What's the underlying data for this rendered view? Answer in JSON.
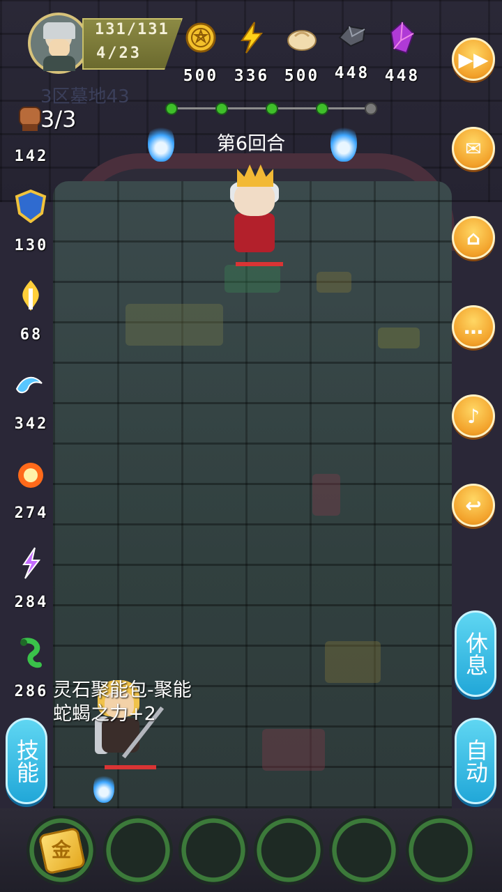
{
  "header": {
    "hp": "131/131",
    "level": "4/23",
    "area": "3区墓地43",
    "resources": [
      {
        "icon": "gold-coin-icon",
        "value": "500"
      },
      {
        "icon": "lightning-energy-icon",
        "value": "336"
      },
      {
        "icon": "bun-food-icon",
        "value": "500"
      },
      {
        "icon": "iron-ore-icon",
        "value": "448"
      },
      {
        "icon": "purple-crystal-icon",
        "value": "448"
      }
    ]
  },
  "battle": {
    "round_label": "第6回合",
    "progress": {
      "total": 5,
      "completed": 4
    },
    "message_line1": "灵石聚能包-聚能",
    "message_line2": "蛇蝎之力+2"
  },
  "stats": {
    "attack_charges": "3/3",
    "items": [
      {
        "icon": "fist-attack-icon",
        "value": "142"
      },
      {
        "icon": "shield-defense-icon",
        "value": "130"
      },
      {
        "icon": "fire-sword-icon",
        "value": "68"
      },
      {
        "icon": "water-wave-icon",
        "value": "342"
      },
      {
        "icon": "fireball-icon",
        "value": "274"
      },
      {
        "icon": "lightning-rune-icon",
        "value": "284"
      },
      {
        "icon": "green-serpent-icon",
        "value": "286"
      }
    ]
  },
  "right_buttons": [
    {
      "name": "fast-forward",
      "icon": "fast-forward-icon"
    },
    {
      "name": "mail",
      "icon": "envelope-icon"
    },
    {
      "name": "home",
      "icon": "home-icon"
    },
    {
      "name": "chat",
      "icon": "chat-bubble-icon"
    },
    {
      "name": "sound",
      "icon": "speaker-icon"
    },
    {
      "name": "return",
      "icon": "return-arrow-icon"
    }
  ],
  "actions": {
    "rest_label": "休息",
    "auto_label": "自动",
    "skills_label": "技能"
  },
  "bottom_slots": {
    "first_slot_glyph": "金",
    "empty_slots": 5
  },
  "colors": {
    "accent_orange": "#f2a12a",
    "accent_blue": "#21a7d8",
    "hp_red": "#d93434",
    "progress_green": "#3fbf2a"
  }
}
